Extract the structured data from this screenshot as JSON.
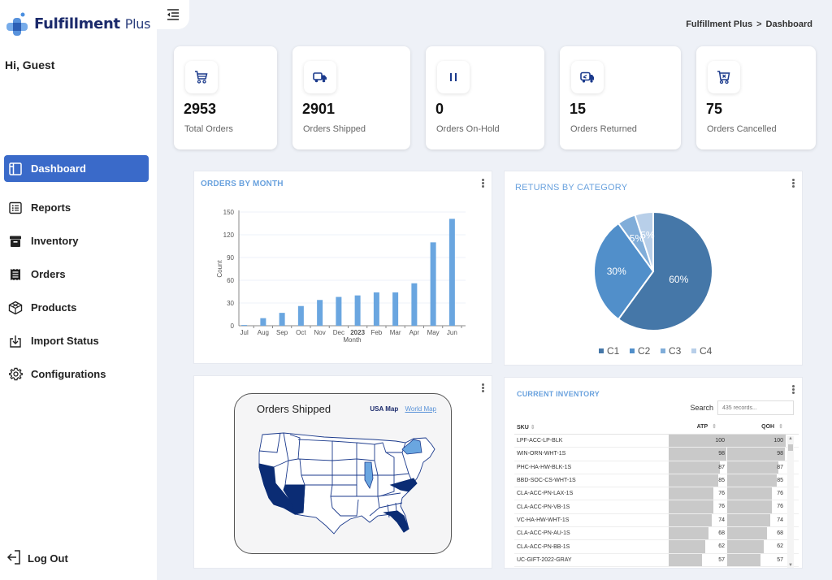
{
  "app": {
    "name": "Fulfillment",
    "name_suffix": "Plus",
    "greeting": "Hi, Guest"
  },
  "breadcrumb": {
    "root": "Fulfillment Plus",
    "separator": ">",
    "current": "Dashboard"
  },
  "sidebar": {
    "items": [
      {
        "label": "Dashboard",
        "icon": "dashboard-icon",
        "active": true
      },
      {
        "label": "Reports",
        "icon": "reports-icon"
      },
      {
        "label": "Inventory",
        "icon": "inventory-icon"
      },
      {
        "label": "Orders",
        "icon": "orders-icon"
      },
      {
        "label": "Products",
        "icon": "products-icon"
      },
      {
        "label": "Import Status",
        "icon": "import-icon"
      },
      {
        "label": "Configurations",
        "icon": "gear-icon"
      }
    ],
    "logout_label": "Log Out"
  },
  "stats": [
    {
      "value": "2953",
      "label": "Total Orders",
      "icon": "cart-icon"
    },
    {
      "value": "2901",
      "label": "Orders Shipped",
      "icon": "truck-icon"
    },
    {
      "value": "0",
      "label": "Orders On-Hold",
      "icon": "pause-icon"
    },
    {
      "value": "15",
      "label": "Orders Returned",
      "icon": "return-truck-icon"
    },
    {
      "value": "75",
      "label": "Orders Cancelled",
      "icon": "cart-cancel-icon"
    }
  ],
  "colors": {
    "accent": "#3a6ac9",
    "bar": "#6aa6e0",
    "panel_title": "#6aa2de",
    "map_dark": "#0b2c74",
    "map_light": "#6aa6e0",
    "pie": [
      "#4577a8",
      "#518fca",
      "#80add9",
      "#b8cfe9"
    ]
  },
  "orders_by_month": {
    "title": "ORDERS BY MONTH"
  },
  "returns_by_category": {
    "title": "RETURNS BY CATEGORY"
  },
  "chart_data": [
    {
      "type": "bar",
      "title": "ORDERS BY MONTH",
      "xlabel": "Month",
      "ylabel": "Count",
      "categories": [
        "Jul",
        "Aug",
        "Sep",
        "Oct",
        "Nov",
        "Dec",
        "2023",
        "Feb",
        "Mar",
        "Apr",
        "May",
        "Jun"
      ],
      "values": [
        1,
        10,
        17,
        26,
        34,
        38,
        40,
        44,
        44,
        56,
        110,
        141
      ],
      "ylim": [
        0,
        150
      ],
      "yticks": [
        0,
        30,
        60,
        90,
        120,
        150
      ],
      "grid": true
    },
    {
      "type": "pie",
      "title": "RETURNS BY CATEGORY",
      "categories": [
        "C1",
        "C2",
        "C3",
        "C4"
      ],
      "values": [
        60,
        30,
        5,
        5
      ],
      "labels": [
        "60%",
        "30%",
        "5%",
        "5%"
      ],
      "legend": "bottom"
    }
  ],
  "map": {
    "title": "Orders Shipped",
    "tab_usa": "USA Map",
    "tab_world": "World Map",
    "states_dark": [
      "CA",
      "AZ",
      "NC",
      "FL"
    ],
    "states_light": [
      "IL",
      "NY"
    ]
  },
  "inventory": {
    "title": "CURRENT INVENTORY",
    "search_label": "Search",
    "search_placeholder": "435 records...",
    "columns": [
      "SKU",
      "ATP",
      "QOH"
    ],
    "max": 100,
    "rows": [
      {
        "sku": "LPF-ACC-LP-BLK",
        "atp": 100,
        "qoh": 100
      },
      {
        "sku": "WIN-ORN-WHT-1S",
        "atp": 98,
        "qoh": 98
      },
      {
        "sku": "PHC-HA-HW-BLK-1S",
        "atp": 87,
        "qoh": 87
      },
      {
        "sku": "BBD-SOC-CS-WHT-1S",
        "atp": 85,
        "qoh": 85
      },
      {
        "sku": "CLA-ACC-PN-LAX-1S",
        "atp": 76,
        "qoh": 76
      },
      {
        "sku": "CLA-ACC-PN-VB-1S",
        "atp": 76,
        "qoh": 76
      },
      {
        "sku": "VC-HA-HW-WHT-1S",
        "atp": 74,
        "qoh": 74
      },
      {
        "sku": "CLA-ACC-PN-AU-1S",
        "atp": 68,
        "qoh": 68
      },
      {
        "sku": "CLA-ACC-PN-BB-1S",
        "atp": 62,
        "qoh": 62
      },
      {
        "sku": "UC-GIFT-2022-GRAY",
        "atp": 57,
        "qoh": 57
      }
    ]
  }
}
